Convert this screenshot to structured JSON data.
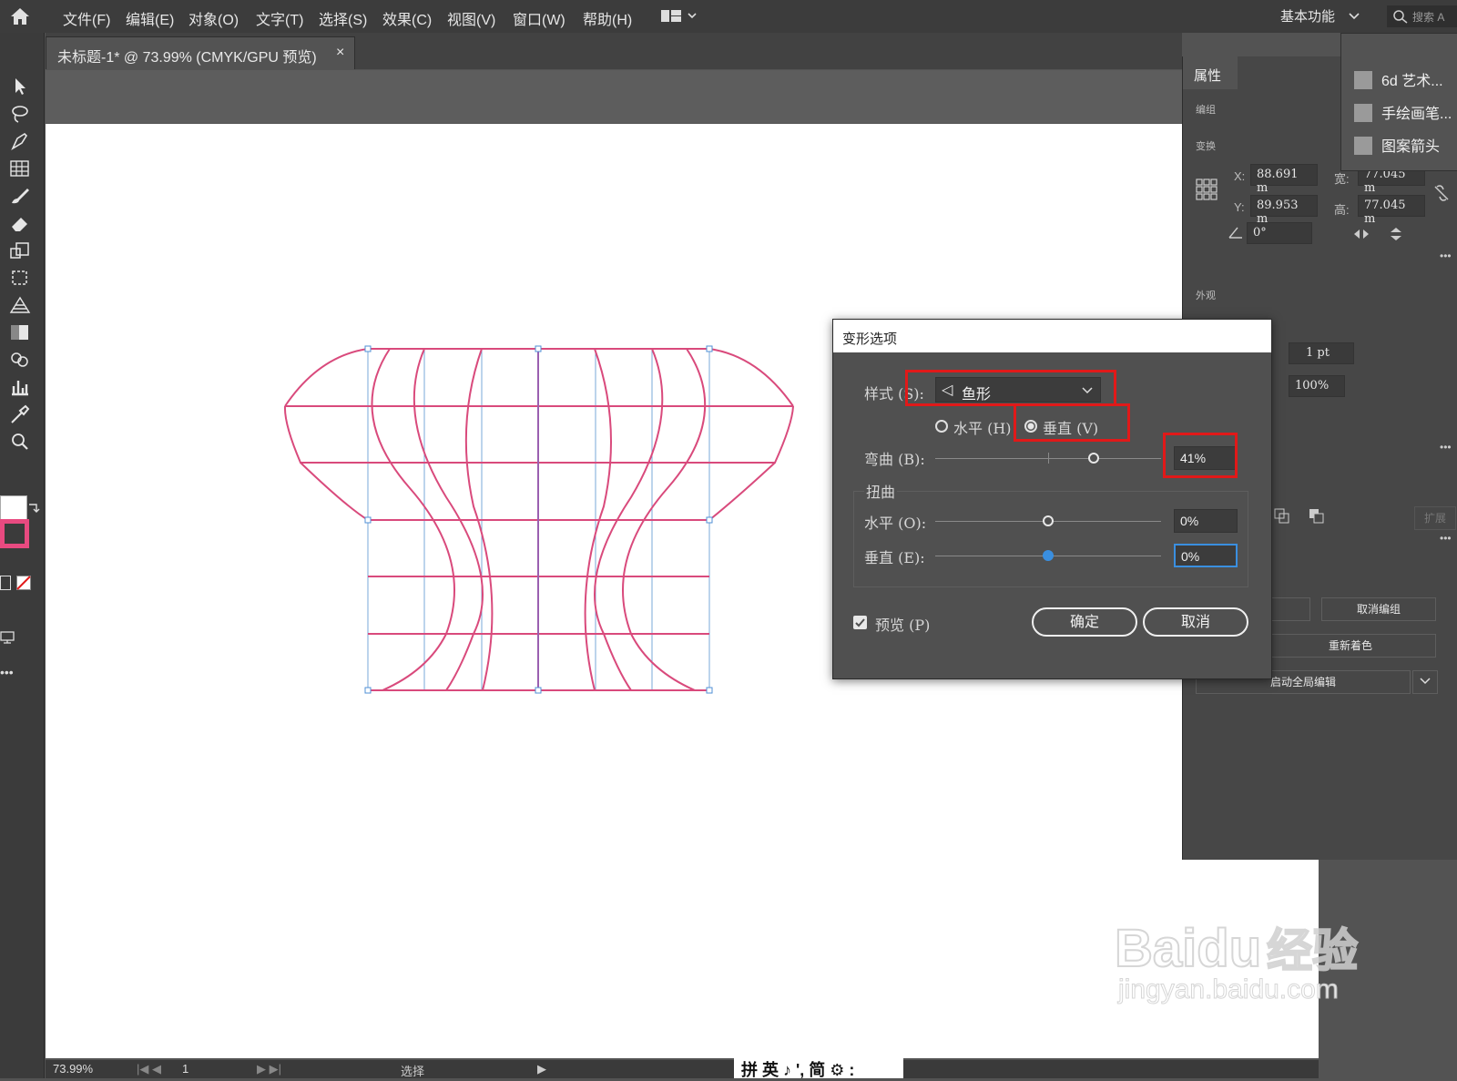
{
  "menubar": {
    "menus": [
      "文件(F)",
      "编辑(E)",
      "对象(O)",
      "文字(T)",
      "选择(S)",
      "效果(C)",
      "视图(V)",
      "窗口(W)",
      "帮助(H)"
    ],
    "workspace": "基本功能",
    "search_placeholder": "搜索 A"
  },
  "document_tab": {
    "title": "未标题-1* @ 73.99% (CMYK/GPU 预览)",
    "close": "×"
  },
  "libraries": {
    "items": [
      "6d 艺术...",
      "手绘画笔...",
      "图案箭头"
    ]
  },
  "properties_panel": {
    "tab": "属性",
    "section_group": "编组",
    "section_transform": "变换",
    "x_label": "X:",
    "x_value": "88.691 m",
    "y_label": "Y:",
    "y_value": "89.953 m",
    "w_label": "宽:",
    "w_value": "77.045 m",
    "h_label": "高:",
    "h_value": "77.045 m",
    "angle": "0°",
    "section_appearance": "外观",
    "stroke_weight": "1 pt",
    "opacity": "100%",
    "expand": "扩展",
    "ungroup": "取消编组",
    "recolor": "重新着色",
    "global_edit": "启动全局编辑"
  },
  "dialog": {
    "title": "变形选项",
    "style_label": "样式 (S):",
    "style_value": "鱼形",
    "horizontal_option": "水平 (H)",
    "vertical_option": "垂直 (V)",
    "selected_orientation": "vertical",
    "bend_label": "弯曲 (B):",
    "bend_value": "41%",
    "distortion_group": "扭曲",
    "dist_h_label": "水平 (O):",
    "dist_h_value": "0%",
    "dist_v_label": "垂直 (E):",
    "dist_v_value": "0%",
    "preview_label": "预览 (P)",
    "preview_checked": true,
    "ok": "确定",
    "cancel": "取消"
  },
  "status": {
    "zoom": "73.99%",
    "artboard": "1",
    "tool": "选择"
  },
  "ime": {
    "text": "拼 英 ♪ ', 简 ⚙ :"
  },
  "watermark": {
    "brand": "Bai",
    "brand2": "du",
    "cn": "经验",
    "url": "jingyan.baidu.com"
  },
  "colors": {
    "accent_red": "#e11919",
    "envelope_pink": "#d94a7c",
    "grid_blue": "#7aa8d8",
    "fill_pink": "#e84a80"
  }
}
